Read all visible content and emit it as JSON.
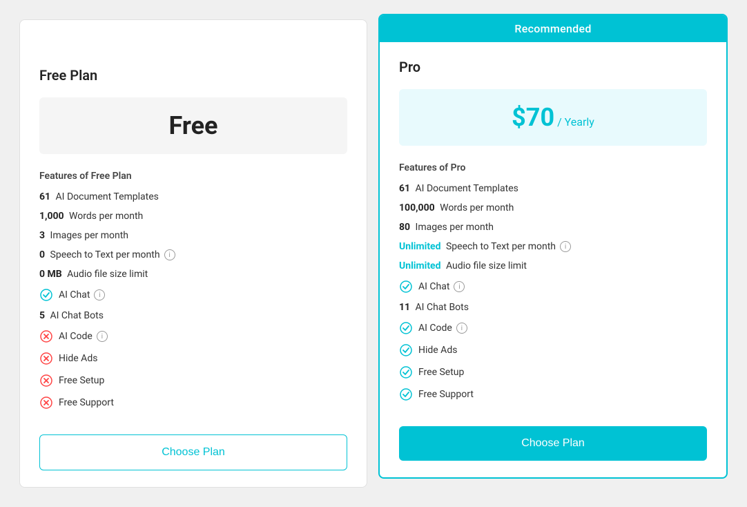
{
  "plans": [
    {
      "id": "free",
      "name": "Free Plan",
      "recommended": false,
      "recommended_label": "",
      "price_display": "Free",
      "price_amount": null,
      "price_period": null,
      "features_heading": "Features of Free Plan",
      "features": [
        {
          "type": "number",
          "num": "61",
          "text": "AI Document Templates",
          "icon": null
        },
        {
          "type": "number",
          "num": "1,000",
          "text": "Words per month",
          "icon": null
        },
        {
          "type": "number",
          "num": "3",
          "text": "Images per month",
          "icon": null
        },
        {
          "type": "number",
          "num": "0",
          "text": "Speech to Text per month",
          "icon": "info",
          "unlimited": false
        },
        {
          "type": "number",
          "num": "0 MB",
          "text": "Audio file size limit",
          "icon": null
        },
        {
          "type": "check",
          "check": true,
          "text": "AI Chat",
          "icon": "info"
        },
        {
          "type": "number",
          "num": "5",
          "text": "AI Chat Bots",
          "icon": null
        },
        {
          "type": "check",
          "check": false,
          "text": "AI Code",
          "icon": "info"
        },
        {
          "type": "check",
          "check": false,
          "text": "Hide Ads",
          "icon": null
        },
        {
          "type": "check",
          "check": false,
          "text": "Free Setup",
          "icon": null
        },
        {
          "type": "check",
          "check": false,
          "text": "Free Support",
          "icon": null
        }
      ],
      "button_label": "Choose Plan"
    },
    {
      "id": "pro",
      "name": "Pro",
      "recommended": true,
      "recommended_label": "Recommended",
      "price_display": null,
      "price_amount": "$70",
      "price_period": "/ Yearly",
      "features_heading": "Features of Pro",
      "features": [
        {
          "type": "number",
          "num": "61",
          "text": "AI Document Templates",
          "icon": null
        },
        {
          "type": "number",
          "num": "100,000",
          "text": "Words per month",
          "icon": null
        },
        {
          "type": "number",
          "num": "80",
          "text": "Images per month",
          "icon": null
        },
        {
          "type": "number",
          "num": "Unlimited",
          "text": "Speech to Text per month",
          "icon": "info",
          "unlimited": true
        },
        {
          "type": "number",
          "num": "Unlimited",
          "text": "Audio file size limit",
          "icon": null,
          "unlimited": true
        },
        {
          "type": "check",
          "check": true,
          "text": "AI Chat",
          "icon": "info"
        },
        {
          "type": "number",
          "num": "11",
          "text": "AI Chat Bots",
          "icon": null
        },
        {
          "type": "check",
          "check": true,
          "text": "AI Code",
          "icon": "info"
        },
        {
          "type": "check",
          "check": true,
          "text": "Hide Ads",
          "icon": null
        },
        {
          "type": "check",
          "check": true,
          "text": "Free Setup",
          "icon": null
        },
        {
          "type": "check",
          "check": true,
          "text": "Free Support",
          "icon": null
        }
      ],
      "button_label": "Choose Plan"
    }
  ],
  "icons": {
    "check": "✓",
    "cross": "✕",
    "info": "i"
  }
}
